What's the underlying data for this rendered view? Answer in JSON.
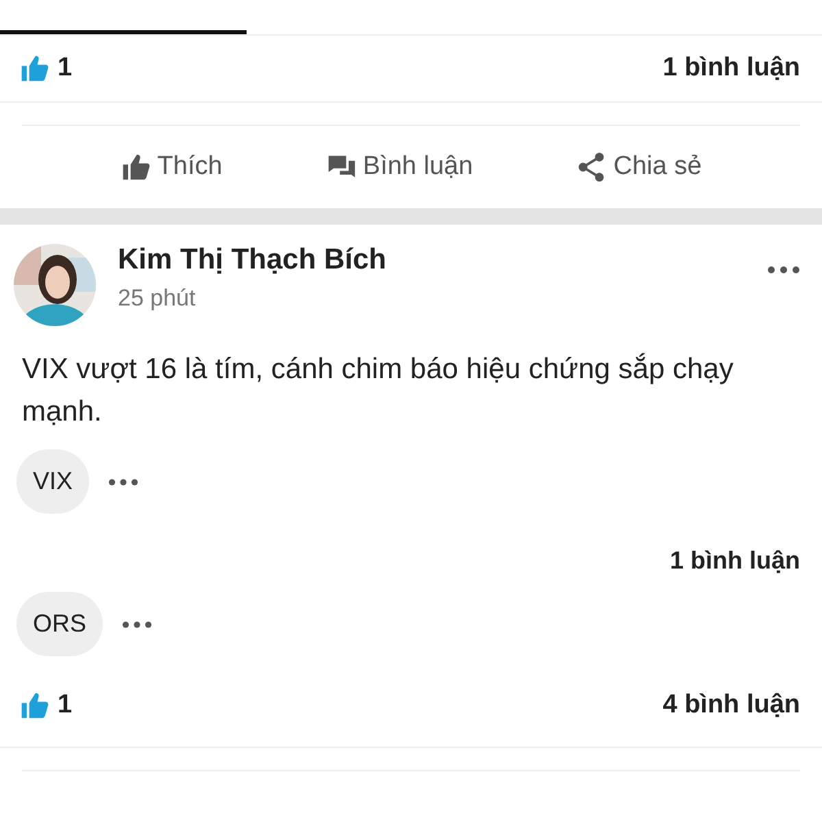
{
  "previous_post": {
    "likes": "1",
    "comments": "1 bình luận",
    "actions": [
      {
        "kind": "like",
        "label": "Thích"
      },
      {
        "kind": "comment",
        "label": "Bình luận"
      },
      {
        "kind": "share",
        "label": "Chia sẻ"
      }
    ]
  },
  "post": {
    "author": "Kim Thị Thạch Bích",
    "time": "25 phút",
    "text": "VIX vượt 16 là tím, cánh chim báo hiệu chứng sắp chạy mạnh.",
    "tags": [
      {
        "label": "VIX",
        "comments": "1 bình luận"
      },
      {
        "label": "ORS"
      }
    ],
    "likes": "1",
    "comments": "4 bình luận"
  }
}
